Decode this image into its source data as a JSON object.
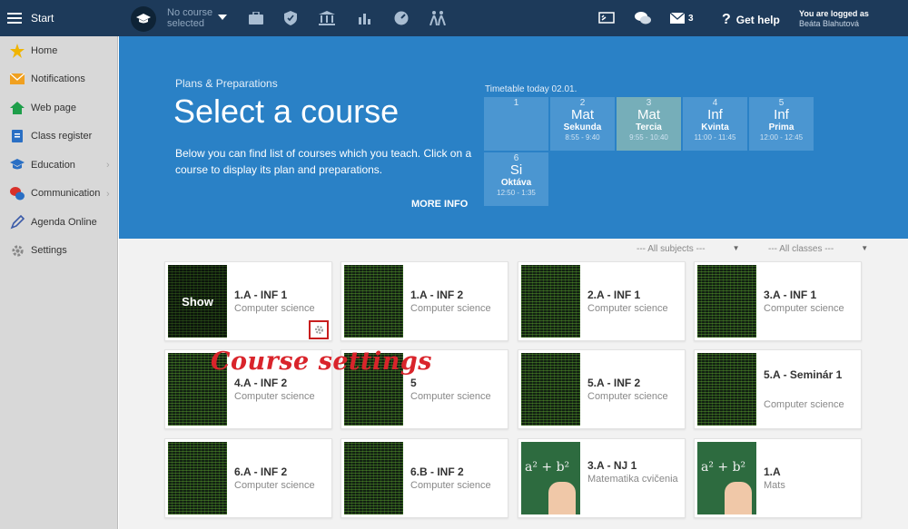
{
  "topbar": {
    "start_label": "Start",
    "course_selector": "No course selected",
    "mail_count": "3",
    "help_label": "Get help",
    "logged_label": "You are logged as",
    "user_name": "Beáta Blahutová"
  },
  "sidebar": {
    "items": [
      {
        "label": "Home",
        "icon": "star-icon"
      },
      {
        "label": "Notifications",
        "icon": "envelope-icon"
      },
      {
        "label": "Web page",
        "icon": "home-icon"
      },
      {
        "label": "Class register",
        "icon": "register-icon"
      },
      {
        "label": "Education",
        "icon": "graduation-icon"
      },
      {
        "label": "Communication",
        "icon": "chat-icon"
      },
      {
        "label": "Agenda Online",
        "icon": "pen-icon"
      },
      {
        "label": "Settings",
        "icon": "gear-icon"
      }
    ]
  },
  "hero": {
    "subtitle": "Plans & Preparations",
    "title": "Select a course",
    "description": "Below you can find list of courses which you teach. Click on a course to display its plan and preparations.",
    "more_info": "MORE INFO"
  },
  "timetable": {
    "label": "Timetable today 02.01.",
    "slots": [
      {
        "num": "1",
        "subject": "",
        "class": "",
        "time": ""
      },
      {
        "num": "2",
        "subject": "Mat",
        "class": "Sekunda",
        "time": "8:55 - 9:40"
      },
      {
        "num": "3",
        "subject": "Mat",
        "class": "Tercia",
        "time": "9:55 - 10:40"
      },
      {
        "num": "4",
        "subject": "Inf",
        "class": "Kvinta",
        "time": "11:00 - 11:45"
      },
      {
        "num": "5",
        "subject": "Inf",
        "class": "Prima",
        "time": "12:00 - 12:45"
      },
      {
        "num": "6",
        "subject": "Si",
        "class": "Oktáva",
        "time": "12:50 - 1:35"
      }
    ]
  },
  "filters": {
    "subjects": "--- All subjects ---",
    "classes": "--- All classes ---"
  },
  "courses": [
    {
      "title": "1.A - INF 1",
      "subject": "Computer science"
    },
    {
      "title": "1.A - INF 2",
      "subject": "Computer science"
    },
    {
      "title": "2.A - INF 1",
      "subject": "Computer science"
    },
    {
      "title": "3.A - INF 1",
      "subject": "Computer science"
    },
    {
      "title": "4.A - INF 2",
      "subject": "Computer science"
    },
    {
      "title": "5",
      "subject": "Computer science"
    },
    {
      "title": "5.A - INF 2",
      "subject": "Computer science"
    },
    {
      "title": "5.A - Seminár 1",
      "subject": "Computer science"
    },
    {
      "title": "6.A - INF 2",
      "subject": "Computer science"
    },
    {
      "title": "6.B - INF 2",
      "subject": "Computer science"
    },
    {
      "title": "3.A - NJ 1",
      "subject": "Matematika cvičenia"
    },
    {
      "title": "1.A",
      "subject": "Mats"
    }
  ],
  "card_hover_label": "Show",
  "math_board_text": "a² + b²",
  "annotation": "Course settings",
  "colors": {
    "topbar": "#1d3a5a",
    "hero": "#2a81c6",
    "annotation": "#d9242b"
  }
}
